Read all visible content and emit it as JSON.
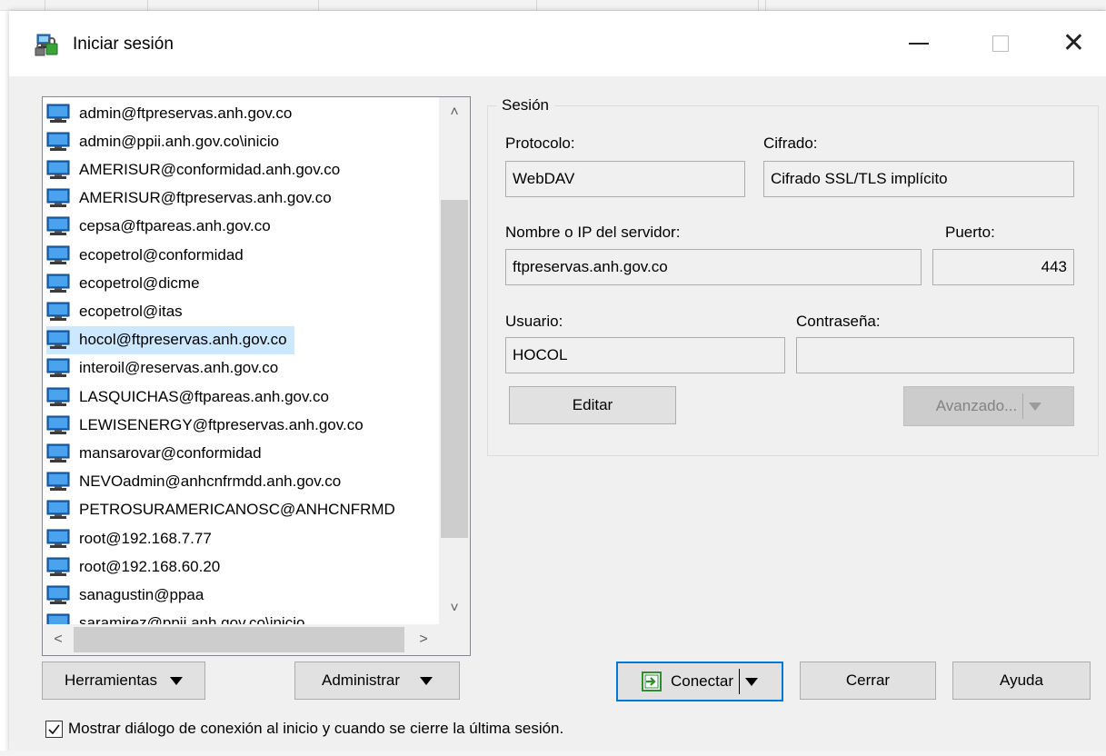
{
  "window": {
    "title": "Iniciar sesión"
  },
  "sessions": {
    "items": [
      "admin@ftpreservas.anh.gov.co",
      "admin@ppii.anh.gov.co\\inicio",
      "AMERISUR@conformidad.anh.gov.co",
      "AMERISUR@ftpreservas.anh.gov.co",
      "cepsa@ftpareas.anh.gov.co",
      "ecopetrol@conformidad",
      "ecopetrol@dicme",
      "ecopetrol@itas",
      "hocol@ftpreservas.anh.gov.co",
      "interoil@reservas.anh.gov.co",
      "LASQUICHAS@ftpareas.anh.gov.co",
      "LEWISENERGY@ftpreservas.anh.gov.co",
      "mansarovar@conformidad",
      "NEVOadmin@anhcnfrmdd.anh.gov.co",
      "PETROSURAMERICANOSC@ANHCNFRMD",
      "root@192.168.7.77",
      "root@192.168.60.20",
      "sanagustin@ppaa",
      "saramirez@ppii.anh.gov.co\\inicio"
    ],
    "selected": "hocol@ftpreservas.anh.gov.co"
  },
  "session_group": {
    "title": "Sesión",
    "protocol_label": "Protocolo:",
    "protocol_value": "WebDAV",
    "encryption_label": "Cifrado:",
    "encryption_value": "Cifrado SSL/TLS implícito",
    "host_label": "Nombre o IP del servidor:",
    "host_value": "ftpreservas.anh.gov.co",
    "port_label": "Puerto:",
    "port_value": "443",
    "user_label": "Usuario:",
    "user_value": "HOCOL",
    "password_label": "Contraseña:",
    "password_value": "",
    "edit_button": "Editar",
    "advanced_button": "Avanzado..."
  },
  "footer": {
    "tools_button": "Herramientas",
    "manage_button": "Administrar",
    "connect_button": "Conectar",
    "close_button": "Cerrar",
    "help_button": "Ayuda",
    "show_dialog_checkbox": "Mostrar diálogo de conexión al inicio y cuando se cierre la última sesión.",
    "show_dialog_checked": true
  },
  "colors": {
    "selection": "#cce8ff",
    "accent": "#0078d7",
    "dialog_bg": "#f0f0f0"
  }
}
